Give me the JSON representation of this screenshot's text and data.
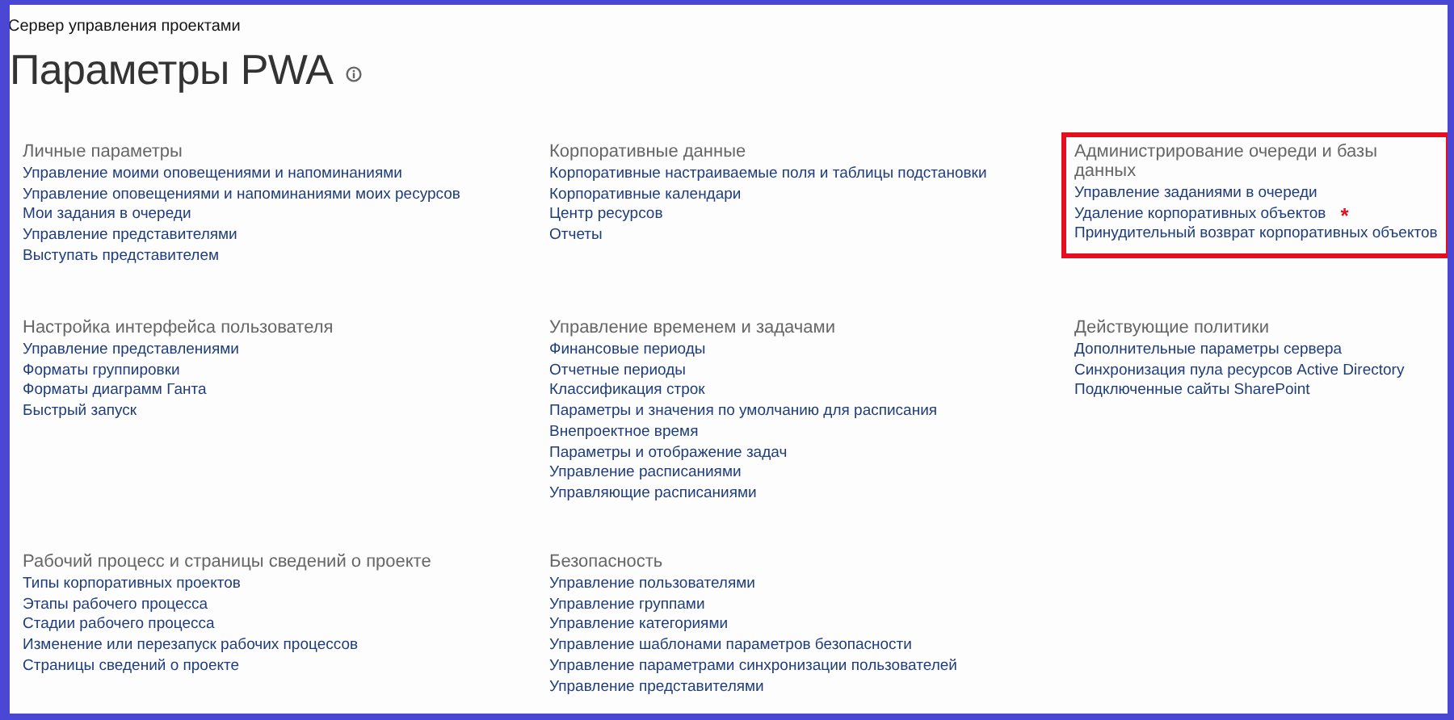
{
  "breadcrumb": "Сервер управления проектами",
  "title": "Параметры PWA",
  "sections": [
    {
      "heading": "Личные параметры",
      "highlighted": false,
      "links": [
        {
          "text": "Управление моими оповещениями и напоминаниями"
        },
        {
          "text": "Управление оповещениями и напоминаниями моих ресурсов"
        },
        {
          "text": "Мои задания в очереди"
        },
        {
          "text": "Управление представителями"
        },
        {
          "text": "Выступать представителем"
        }
      ]
    },
    {
      "heading": "Корпоративные данные",
      "highlighted": false,
      "links": [
        {
          "text": "Корпоративные настраиваемые поля и таблицы подстановки"
        },
        {
          "text": "Корпоративные календари"
        },
        {
          "text": "Центр ресурсов"
        },
        {
          "text": "Отчеты"
        }
      ]
    },
    {
      "heading": "Администрирование очереди и базы данных",
      "highlighted": true,
      "links": [
        {
          "text": "Управление заданиями в очереди"
        },
        {
          "text": "Удаление корпоративных объектов",
          "note": "*"
        },
        {
          "text": "Принудительный возврат корпоративных объектов"
        }
      ]
    },
    {
      "heading": "Настройка интерфейса пользователя",
      "highlighted": false,
      "links": [
        {
          "text": "Управление представлениями"
        },
        {
          "text": "Форматы группировки"
        },
        {
          "text": "Форматы диаграмм Ганта"
        },
        {
          "text": "Быстрый запуск"
        }
      ]
    },
    {
      "heading": "Управление временем и задачами",
      "highlighted": false,
      "links": [
        {
          "text": "Финансовые периоды"
        },
        {
          "text": "Отчетные периоды"
        },
        {
          "text": "Классификация строк"
        },
        {
          "text": "Параметры и значения по умолчанию для расписания"
        },
        {
          "text": "Внепроектное время"
        },
        {
          "text": "Параметры и отображение задач"
        },
        {
          "text": "Управление расписаниями"
        },
        {
          "text": "Управляющие расписаниями"
        }
      ]
    },
    {
      "heading": "Действующие политики",
      "highlighted": false,
      "links": [
        {
          "text": "Дополнительные параметры сервера"
        },
        {
          "text": "Синхронизация пула ресурсов Active Directory"
        },
        {
          "text": "Подключенные сайты SharePoint"
        }
      ]
    },
    {
      "heading": "Рабочий процесс и страницы сведений о проекте",
      "highlighted": false,
      "links": [
        {
          "text": "Типы корпоративных проектов"
        },
        {
          "text": "Этапы рабочего процесса"
        },
        {
          "text": "Стадии рабочего процесса"
        },
        {
          "text": "Изменение или перезапуск рабочих процессов"
        },
        {
          "text": "Страницы сведений о проекте"
        }
      ]
    },
    {
      "heading": "Безопасность",
      "highlighted": false,
      "links": [
        {
          "text": "Управление пользователями"
        },
        {
          "text": "Управление группами"
        },
        {
          "text": "Управление категориями"
        },
        {
          "text": "Управление шаблонами параметров безопасности"
        },
        {
          "text": "Управление параметрами синхронизации пользователей"
        },
        {
          "text": "Управление представителями"
        }
      ]
    }
  ]
}
